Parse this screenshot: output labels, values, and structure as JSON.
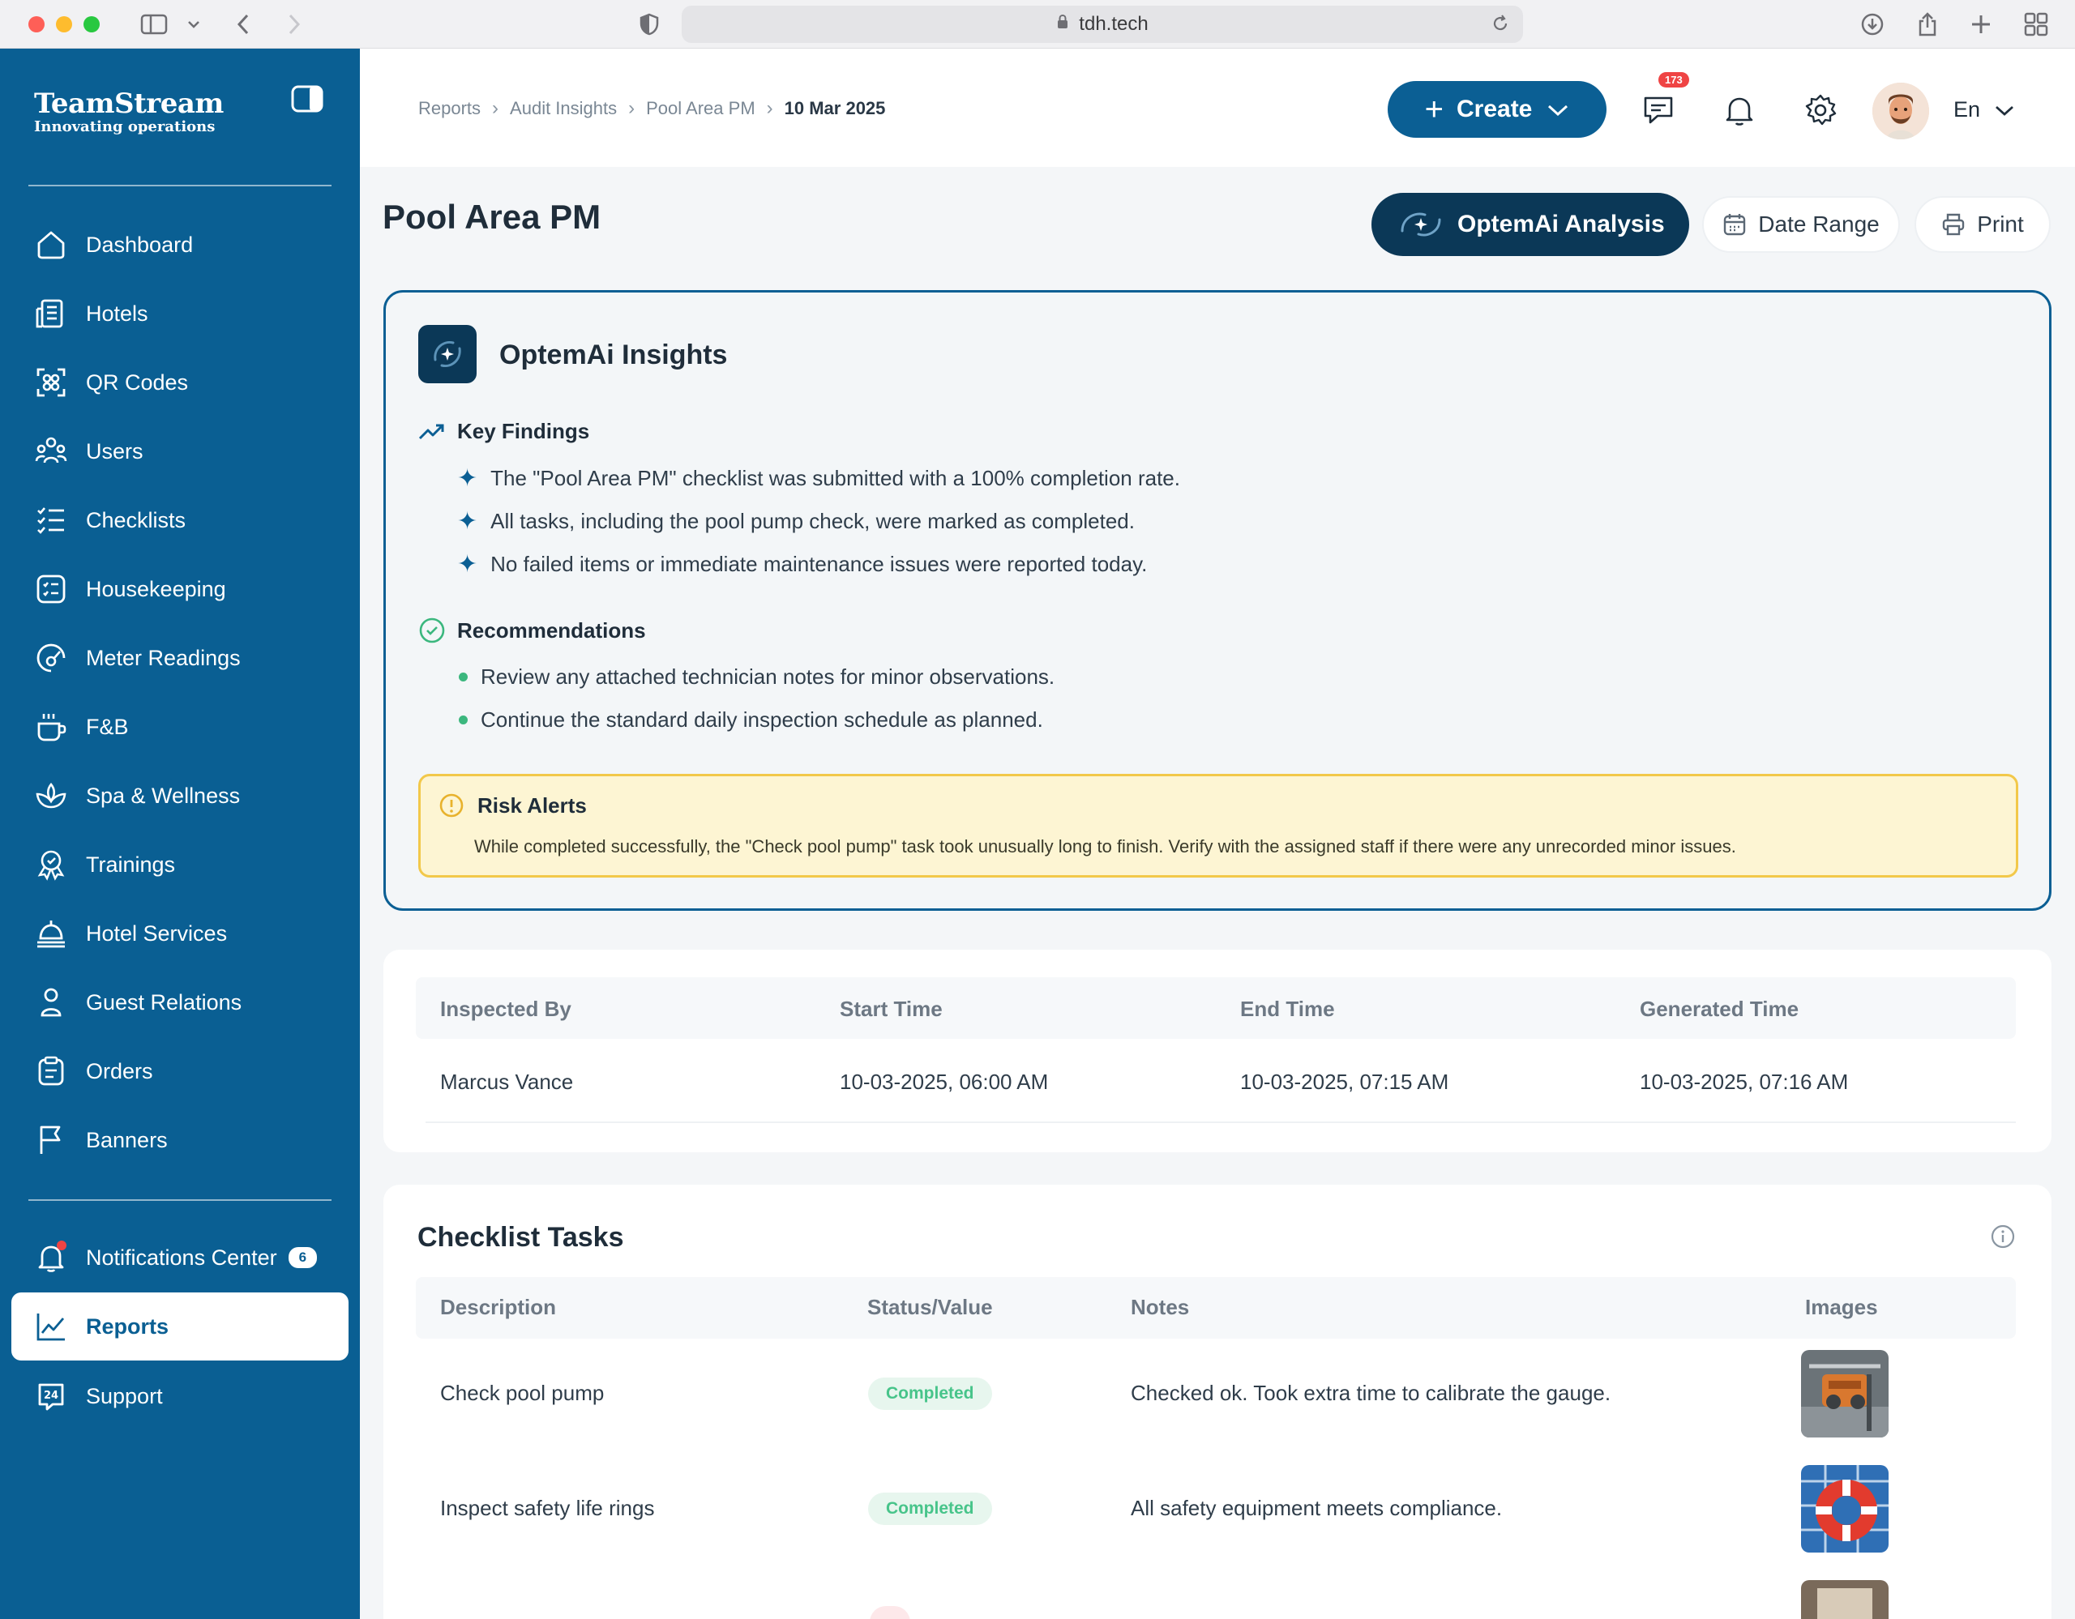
{
  "browser": {
    "url": "tdh.tech"
  },
  "brand": {
    "name": "TeamStream",
    "tagline": "Innovating operations"
  },
  "sidebar": {
    "items": [
      {
        "label": "Dashboard",
        "icon": "home-icon"
      },
      {
        "label": "Hotels",
        "icon": "building-icon"
      },
      {
        "label": "QR Codes",
        "icon": "qr-code-icon"
      },
      {
        "label": "Users",
        "icon": "users-icon"
      },
      {
        "label": "Checklists",
        "icon": "checklist-icon"
      },
      {
        "label": "Housekeeping",
        "icon": "housekeeping-icon"
      },
      {
        "label": "Meter Readings",
        "icon": "meter-icon"
      },
      {
        "label": "F&B",
        "icon": "food-icon"
      },
      {
        "label": "Spa & Wellness",
        "icon": "spa-icon"
      },
      {
        "label": "Trainings",
        "icon": "award-icon"
      },
      {
        "label": "Hotel Services",
        "icon": "bell-service-icon"
      },
      {
        "label": "Guest Relations",
        "icon": "person-icon"
      },
      {
        "label": "Orders",
        "icon": "clipboard-icon"
      },
      {
        "label": "Banners",
        "icon": "flag-icon"
      }
    ],
    "bottom": [
      {
        "label": "Notifications Center",
        "icon": "bell-icon",
        "badge": "6"
      },
      {
        "label": "Reports",
        "icon": "chart-icon",
        "active": true
      },
      {
        "label": "Support",
        "icon": "support-24-icon"
      }
    ]
  },
  "header": {
    "breadcrumb": [
      "Reports",
      "Audit Insights",
      "Pool Area PM",
      "10 Mar 2025"
    ],
    "create_label": "Create",
    "messages_badge": "173",
    "language": "En"
  },
  "page": {
    "title": "Pool Area PM",
    "ai_button": "OptemAi Analysis",
    "date_range_button": "Date Range",
    "print_button": "Print"
  },
  "insights": {
    "title": "OptemAi Insights",
    "key_findings_label": "Key Findings",
    "findings": [
      "The \"Pool Area PM\" checklist was submitted with a 100% completion rate.",
      "All tasks, including the pool pump check, were marked as completed.",
      "No failed items or immediate maintenance issues were reported today."
    ],
    "recommendations_label": "Recommendations",
    "recommendations": [
      "Review any attached technician notes for minor observations.",
      "Continue the standard daily inspection schedule as planned."
    ],
    "risk_label": "Risk Alerts",
    "risk_text": "While completed successfully, the \"Check pool pump\" task took unusually long to finish. Verify with the assigned staff if there were any unrecorded minor issues."
  },
  "inspection": {
    "headers": [
      "Inspected By",
      "Start Time",
      "End Time",
      "Generated Time"
    ],
    "values": [
      "Marcus Vance",
      "10-03-2025, 06:00 AM",
      "10-03-2025, 07:15 AM",
      "10-03-2025, 07:16 AM"
    ]
  },
  "checklist": {
    "title": "Checklist Tasks",
    "headers": [
      "Description",
      "Status/Value",
      "Notes",
      "Images"
    ],
    "rows": [
      {
        "description": "Check pool pump",
        "status": "Completed",
        "notes": "Checked ok. Took extra time to calibrate the gauge."
      },
      {
        "description": "Inspect safety life rings",
        "status": "Completed",
        "notes": "All safety equipment meets compliance."
      }
    ]
  },
  "colors": {
    "primary": "#0a5f93",
    "dark": "#0b3857",
    "success": "#47c48a",
    "warning": "#f2c84a",
    "danger": "#ef4444"
  }
}
